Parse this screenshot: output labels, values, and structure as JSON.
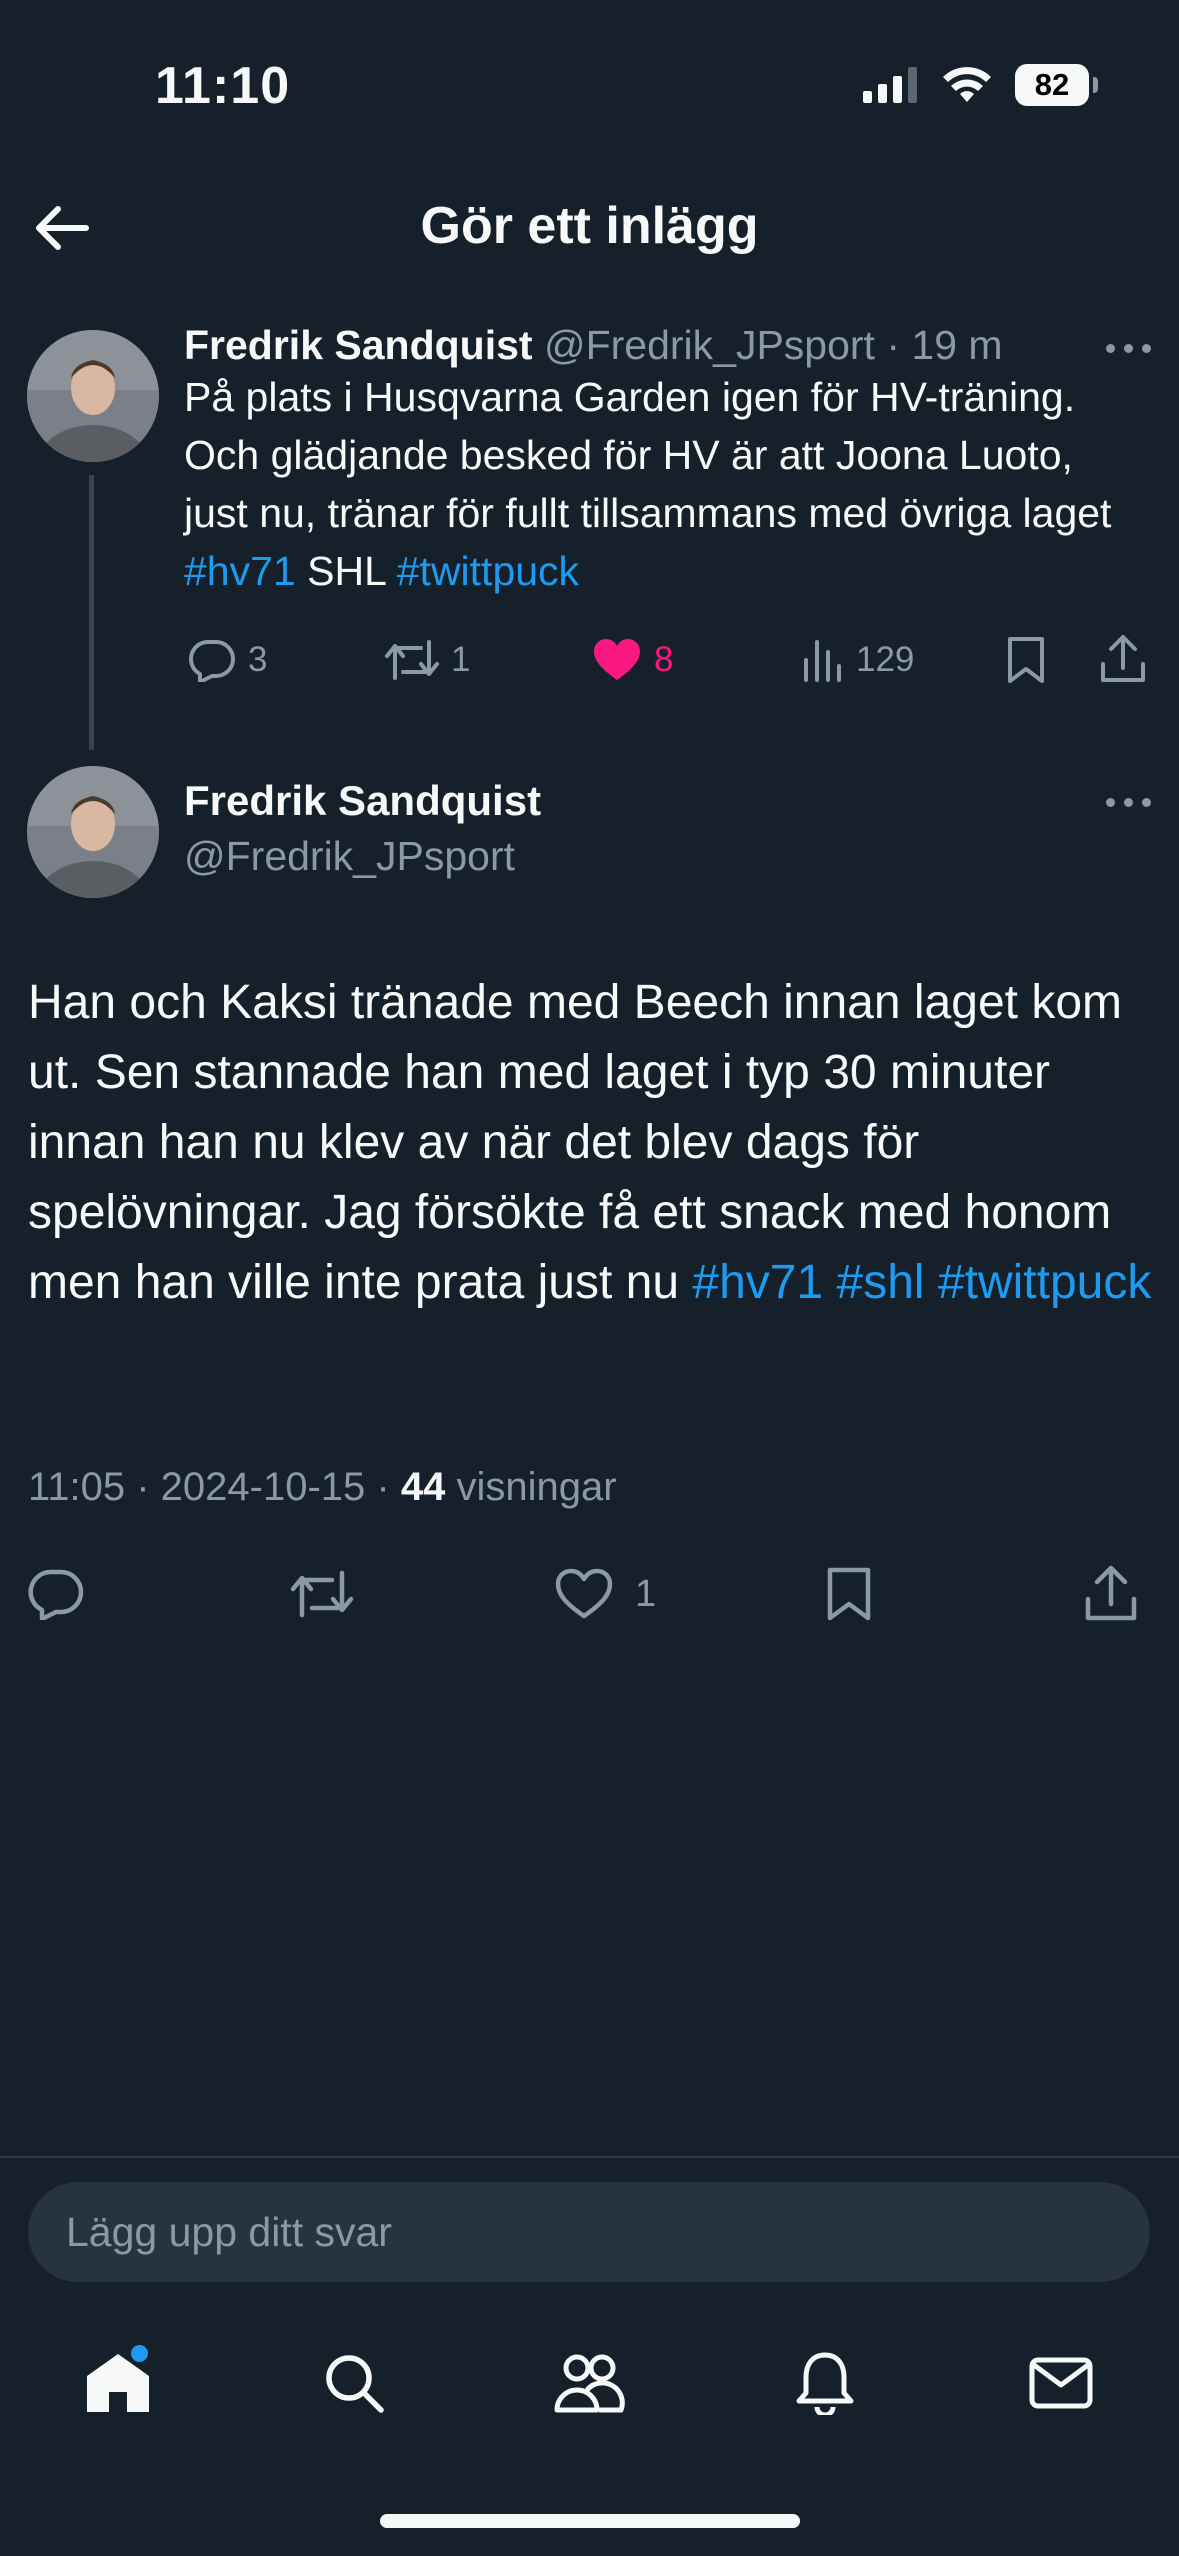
{
  "status_bar": {
    "time": "11:10",
    "battery": "82"
  },
  "header": {
    "title": "Gör ett inlägg"
  },
  "parent_post": {
    "author_name": "Fredrik Sandquist",
    "handle": "@Fredrik_JPsport",
    "time_ago": "· 19 m",
    "text_parts": [
      {
        "text": "På plats i Husqvarna Garden igen för HV-träning. Och glädjande besked för HV är att Joona Luoto, just nu, tränar för fullt tillsammans med övriga laget ",
        "link": false
      },
      {
        "text": "#hv71",
        "link": true
      },
      {
        "text": " SHL ",
        "link": false
      },
      {
        "text": "#twittpuck",
        "link": true
      }
    ],
    "stats": {
      "replies": "3",
      "reposts": "1",
      "likes": "8",
      "views": "129"
    },
    "like_color": "#f91880"
  },
  "reply_post": {
    "author_name": "Fredrik Sandquist",
    "handle": "@Fredrik_JPsport",
    "text_parts": [
      {
        "text": "Han och Kaksi tränade med Beech innan laget kom ut. Sen stannade han med laget i typ 30 minuter innan han nu klev av när det blev dags för spelövningar. Jag försökte få ett snack med honom men han ville inte prata just nu ",
        "link": false
      },
      {
        "text": "#hv71",
        "link": true
      },
      {
        "text": " ",
        "link": false
      },
      {
        "text": "#shl",
        "link": true
      },
      {
        "text": " ",
        "link": false
      },
      {
        "text": "#twittpuck",
        "link": true
      }
    ],
    "meta_time": "11:05 · 2024-10-15 · ",
    "meta_views_count": "44",
    "meta_views_label": " visningar",
    "likes": "1"
  },
  "composer": {
    "placeholder": "Lägg upp ditt svar"
  },
  "colors": {
    "background": "#15202b",
    "accent": "#1d9bf0",
    "muted": "#8b98a5"
  },
  "tabbar": {
    "icons": [
      "home-icon",
      "search-icon",
      "communities-icon",
      "notifications-icon",
      "messages-icon"
    ]
  }
}
